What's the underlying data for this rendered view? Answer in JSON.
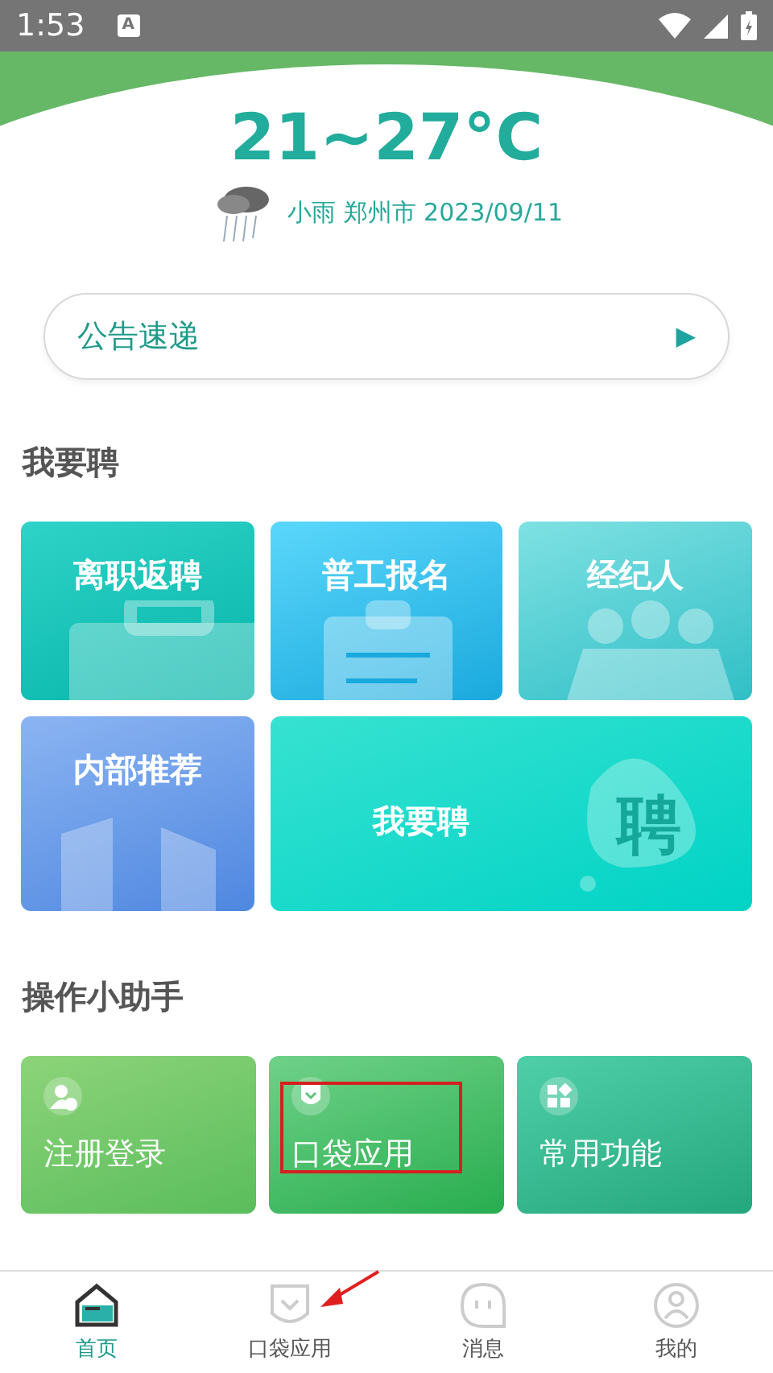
{
  "status_bar": {
    "time": "1:53",
    "badge": "A"
  },
  "weather": {
    "temperature": "21~27°C",
    "summary": "小雨 郑州市 2023/09/11"
  },
  "notice": {
    "label": "公告速递",
    "arrow": "▶"
  },
  "recruit": {
    "title": "我要聘",
    "tiles": [
      {
        "label": "离职返聘",
        "kind": "briefcase"
      },
      {
        "label": "普工报名",
        "kind": "clipboard"
      },
      {
        "label": "经纪人",
        "kind": "people"
      },
      {
        "label": "内部推荐",
        "kind": "building"
      },
      {
        "label": "我要聘",
        "kind": "bubble",
        "bubble_text": "聘"
      }
    ]
  },
  "assistant": {
    "title": "操作小助手",
    "cards": [
      {
        "label": "注册登录",
        "kind": "user-add",
        "highlighted": false
      },
      {
        "label": "口袋应用",
        "kind": "pocket",
        "highlighted": true
      },
      {
        "label": "常用功能",
        "kind": "grid",
        "highlighted": false
      }
    ]
  },
  "tab_bar": [
    {
      "label": "首页",
      "kind": "home",
      "selected": true,
      "pointed": false
    },
    {
      "label": "口袋应用",
      "kind": "pocket",
      "selected": false,
      "pointed": true
    },
    {
      "label": "消息",
      "kind": "message",
      "selected": false,
      "pointed": false
    },
    {
      "label": "我的",
      "kind": "person",
      "selected": false,
      "pointed": false
    }
  ]
}
